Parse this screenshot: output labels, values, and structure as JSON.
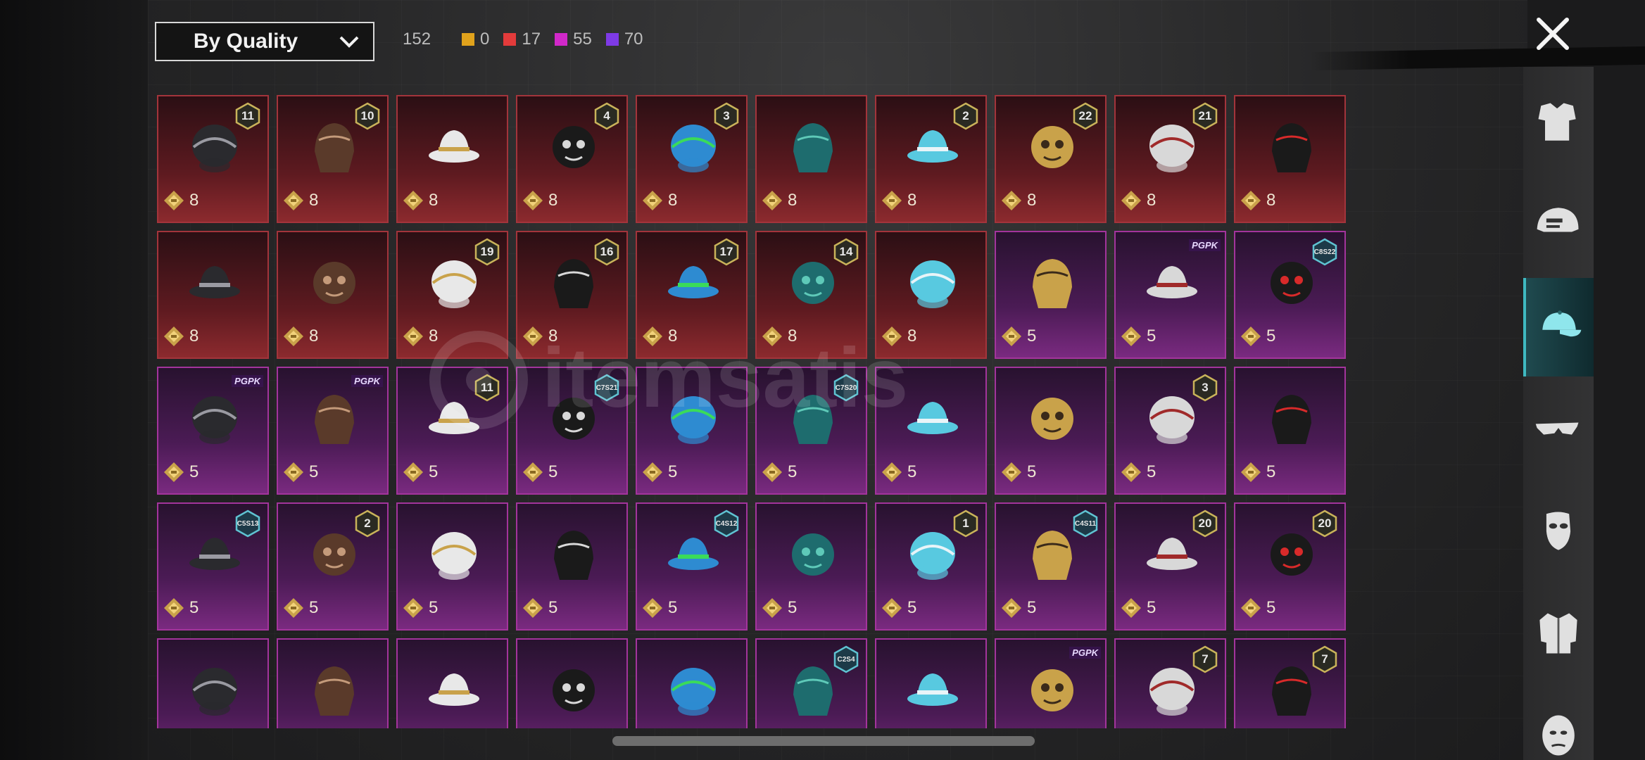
{
  "sort": {
    "label": "By Quality"
  },
  "counts": {
    "total": "152",
    "by_quality": [
      {
        "color": "#e0a21c",
        "value": "0"
      },
      {
        "color": "#e33b3b",
        "value": "17"
      },
      {
        "color": "#d128c9",
        "value": "55"
      },
      {
        "color": "#7e3ae6",
        "value": "70"
      }
    ]
  },
  "grid": {
    "items": [
      {
        "quality": "red",
        "badge": "11",
        "points": "8",
        "icon": "helmet-icon"
      },
      {
        "quality": "red",
        "badge": "10",
        "points": "8",
        "icon": "hair-icon"
      },
      {
        "quality": "red",
        "badge": "",
        "points": "8",
        "icon": "cowboy-hat-icon"
      },
      {
        "quality": "red",
        "badge": "4",
        "points": "8",
        "icon": "top-hat-mask-icon"
      },
      {
        "quality": "red",
        "badge": "3",
        "points": "8",
        "icon": "joker-head-icon"
      },
      {
        "quality": "red",
        "badge": "",
        "points": "8",
        "icon": "dragon-helmet-icon"
      },
      {
        "quality": "red",
        "badge": "2",
        "points": "8",
        "icon": "visor-helmet-icon"
      },
      {
        "quality": "red",
        "badge": "22",
        "points": "8",
        "icon": "golden-helm-icon"
      },
      {
        "quality": "red",
        "badge": "21",
        "points": "8",
        "icon": "clown-head-icon"
      },
      {
        "quality": "red",
        "badge": "",
        "points": "8",
        "icon": "samurai-mask-icon"
      },
      {
        "quality": "red",
        "badge": "",
        "points": "8",
        "icon": "dark-helmet-icon"
      },
      {
        "quality": "red",
        "badge": "",
        "points": "8",
        "icon": "shark-helmet-icon"
      },
      {
        "quality": "red",
        "badge": "19",
        "points": "8",
        "icon": "oni-helmet-icon"
      },
      {
        "quality": "red",
        "badge": "16",
        "points": "8",
        "icon": "cyber-helmet-icon"
      },
      {
        "quality": "red",
        "badge": "17",
        "points": "8",
        "icon": "winged-helmet-icon"
      },
      {
        "quality": "red",
        "badge": "14",
        "points": "8",
        "icon": "officer-cap-icon"
      },
      {
        "quality": "red",
        "badge": "",
        "points": "8",
        "icon": "racing-helmet-icon"
      },
      {
        "quality": "purple",
        "badge": "",
        "points": "5",
        "icon": "brown-hair-icon"
      },
      {
        "quality": "purple",
        "badge": "PGPK",
        "points": "5",
        "icon": "cap-goggles-icon"
      },
      {
        "quality": "purple",
        "badge": "C8S22",
        "points": "5",
        "icon": "blue-hair-icon"
      },
      {
        "quality": "purple",
        "badge": "PGPK",
        "points": "5",
        "icon": "red-hair-icon"
      },
      {
        "quality": "purple",
        "badge": "PGPK",
        "points": "5",
        "icon": "panda-head-icon"
      },
      {
        "quality": "purple",
        "badge": "11",
        "points": "5",
        "icon": "flower-crown-icon"
      },
      {
        "quality": "purple",
        "badge": "C7S21",
        "points": "5",
        "icon": "white-hair-icon"
      },
      {
        "quality": "purple",
        "badge": "",
        "points": "5",
        "icon": "phoenix-hat-icon"
      },
      {
        "quality": "purple",
        "badge": "C7S20",
        "points": "5",
        "icon": "green-hair-icon"
      },
      {
        "quality": "purple",
        "badge": "",
        "points": "5",
        "icon": "pumpkin-head-icon"
      },
      {
        "quality": "purple",
        "badge": "",
        "points": "5",
        "icon": "eagle-head-icon"
      },
      {
        "quality": "purple",
        "badge": "3",
        "points": "5",
        "icon": "jester-hat-icon"
      },
      {
        "quality": "purple",
        "badge": "",
        "points": "5",
        "icon": "wide-brim-hat-icon"
      },
      {
        "quality": "purple",
        "badge": "C5S13",
        "points": "5",
        "icon": "teal-beanie-icon"
      },
      {
        "quality": "purple",
        "badge": "2",
        "points": "5",
        "icon": "blonde-bandana-icon"
      },
      {
        "quality": "purple",
        "badge": "",
        "points": "5",
        "icon": "cactus-beanie-icon"
      },
      {
        "quality": "purple",
        "badge": "",
        "points": "5",
        "icon": "neon-helmet-icon"
      },
      {
        "quality": "purple",
        "badge": "C4S12",
        "points": "5",
        "icon": "visor-band-icon"
      },
      {
        "quality": "purple",
        "badge": "",
        "points": "5",
        "icon": "potato-head-icon"
      },
      {
        "quality": "purple",
        "badge": "1",
        "points": "5",
        "icon": "twin-tail-hair-icon"
      },
      {
        "quality": "purple",
        "badge": "C4S11",
        "points": "5",
        "icon": "red-cap-icon"
      },
      {
        "quality": "purple",
        "badge": "20",
        "points": "5",
        "icon": "bunny-hat-icon"
      },
      {
        "quality": "purple",
        "badge": "20",
        "points": "5",
        "icon": "gold-mask-icon"
      },
      {
        "quality": "purple",
        "badge": "",
        "points": "",
        "icon": "blue-demon-icon"
      },
      {
        "quality": "purple",
        "badge": "",
        "points": "",
        "icon": "pigtails-icon"
      },
      {
        "quality": "purple",
        "badge": "",
        "points": "",
        "icon": "duck-headphones-icon"
      },
      {
        "quality": "purple",
        "badge": "",
        "points": "",
        "icon": "white-hood-icon"
      },
      {
        "quality": "purple",
        "badge": "",
        "points": "",
        "icon": "horned-helmet-icon"
      },
      {
        "quality": "purple",
        "badge": "C2S4",
        "points": "",
        "icon": "silver-hair-icon"
      },
      {
        "quality": "purple",
        "badge": "",
        "points": "",
        "icon": "knight-helmet-icon"
      },
      {
        "quality": "purple",
        "badge": "PGPK",
        "points": "",
        "icon": "cat-head-icon"
      },
      {
        "quality": "purple",
        "badge": "7",
        "points": "",
        "icon": "crown-hood-icon"
      },
      {
        "quality": "purple",
        "badge": "7",
        "points": "",
        "icon": "peaked-cap-icon"
      }
    ]
  },
  "sidebar": {
    "items": [
      {
        "icon": "outfit-icon",
        "active": false
      },
      {
        "icon": "helmet-icon",
        "active": false
      },
      {
        "icon": "cap-icon",
        "active": true
      },
      {
        "icon": "glasses-icon",
        "active": false
      },
      {
        "icon": "face-mask-icon",
        "active": false
      },
      {
        "icon": "jacket-icon",
        "active": false
      },
      {
        "icon": "face-icon",
        "active": false
      }
    ]
  },
  "colors": {
    "legendary": "#e0a21c",
    "mythic": "#e33b3b",
    "epic": "#d128c9",
    "rare": "#7e3ae6",
    "active_tab": "#3fb9c1"
  },
  "watermark": {
    "text": "itemsatis"
  }
}
